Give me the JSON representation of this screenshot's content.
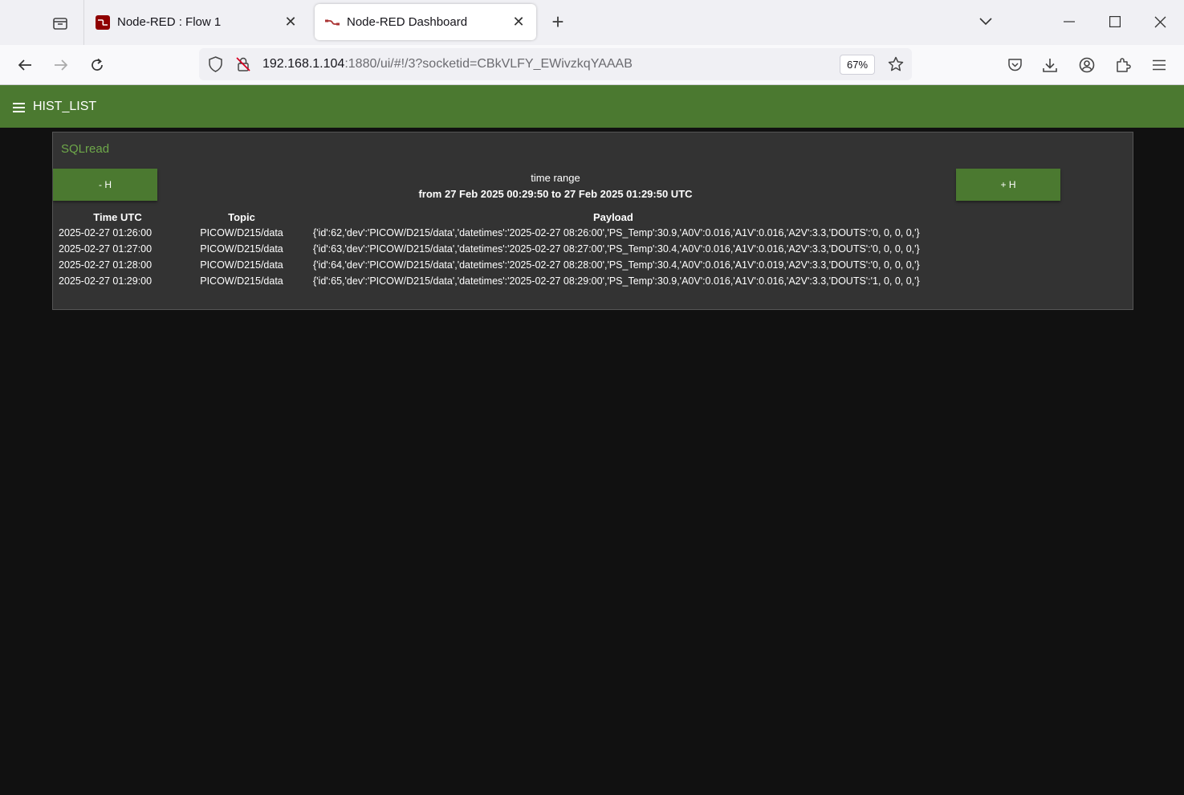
{
  "browser": {
    "tabs": [
      {
        "title": "Node-RED : Flow 1",
        "active": false
      },
      {
        "title": "Node-RED Dashboard",
        "active": true
      }
    ],
    "url_host": "192.168.1.104",
    "url_rest": ":1880/ui/#!/3?socketid=CBkVLFY_EWivzkqYAAAB",
    "zoom": "67%"
  },
  "dashboard": {
    "title": "HIST_LIST",
    "accent_color": "#4b7930"
  },
  "card": {
    "title": "SQLread",
    "minus_button": "- H",
    "plus_button": "+ H",
    "range_label": "time range",
    "range_value": "from 27 Feb 2025 00:29:50 to 27 Feb 2025 01:29:50 UTC"
  },
  "table": {
    "headers": [
      "Time UTC",
      "Topic",
      "Payload"
    ],
    "rows": [
      [
        "2025-02-27 01:26:00",
        "PICOW/D215/data",
        "{'id':62,'dev':'PICOW/D215/data','datetimes':'2025-02-27 08:26:00','PS_Temp':30.9,'A0V':0.016,'A1V':0.016,'A2V':3.3,'DOUTS':'0, 0, 0, 0,'}"
      ],
      [
        "2025-02-27 01:27:00",
        "PICOW/D215/data",
        "{'id':63,'dev':'PICOW/D215/data','datetimes':'2025-02-27 08:27:00','PS_Temp':30.4,'A0V':0.016,'A1V':0.016,'A2V':3.3,'DOUTS':'0, 0, 0, 0,'}"
      ],
      [
        "2025-02-27 01:28:00",
        "PICOW/D215/data",
        "{'id':64,'dev':'PICOW/D215/data','datetimes':'2025-02-27 08:28:00','PS_Temp':30.4,'A0V':0.016,'A1V':0.019,'A2V':3.3,'DOUTS':'0, 0, 0, 0,'}"
      ],
      [
        "2025-02-27 01:29:00",
        "PICOW/D215/data",
        "{'id':65,'dev':'PICOW/D215/data','datetimes':'2025-02-27 08:29:00','PS_Temp':30.9,'A0V':0.016,'A1V':0.016,'A2V':3.3,'DOUTS':'1, 0, 0, 0,'}"
      ]
    ]
  }
}
